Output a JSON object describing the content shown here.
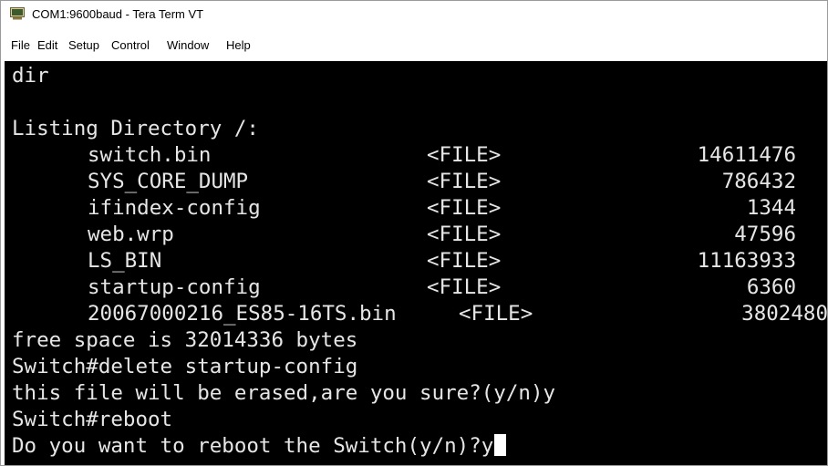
{
  "window": {
    "title": "COM1:9600baud - Tera Term VT",
    "app_icon": "tera-term-icon"
  },
  "menu": [
    "File",
    "Edit",
    "Setup",
    "Control",
    "Window",
    "Help"
  ],
  "terminal": {
    "cmd_dir": "dir",
    "listing_header": "Listing Directory /:",
    "files": [
      {
        "name": "switch.bin",
        "type": "<FILE>",
        "size": "14611476"
      },
      {
        "name": "SYS_CORE_DUMP",
        "type": "<FILE>",
        "size": "786432"
      },
      {
        "name": "ifindex-config",
        "type": "<FILE>",
        "size": "1344"
      },
      {
        "name": "web.wrp",
        "type": "<FILE>",
        "size": "47596"
      },
      {
        "name": "LS_BIN",
        "type": "<FILE>",
        "size": "11163933"
      },
      {
        "name": "startup-config",
        "type": "<FILE>",
        "size": "6360"
      },
      {
        "name": "20067000216_ES85-16TS.bin",
        "type": "<FILE>",
        "size": "3802480"
      }
    ],
    "free_space": "free space is 32014336 bytes",
    "cmd_delete": "Switch#delete startup-config",
    "confirm_erase": "this file will be erased,are you sure?(y/n)y",
    "cmd_reboot": "Switch#reboot",
    "confirm_reboot": "Do you want to reboot the Switch(y/n)?y"
  },
  "colors": {
    "terminal_bg": "#000000",
    "terminal_fg": "#e6e6e6",
    "cursor": "#ffffff"
  }
}
